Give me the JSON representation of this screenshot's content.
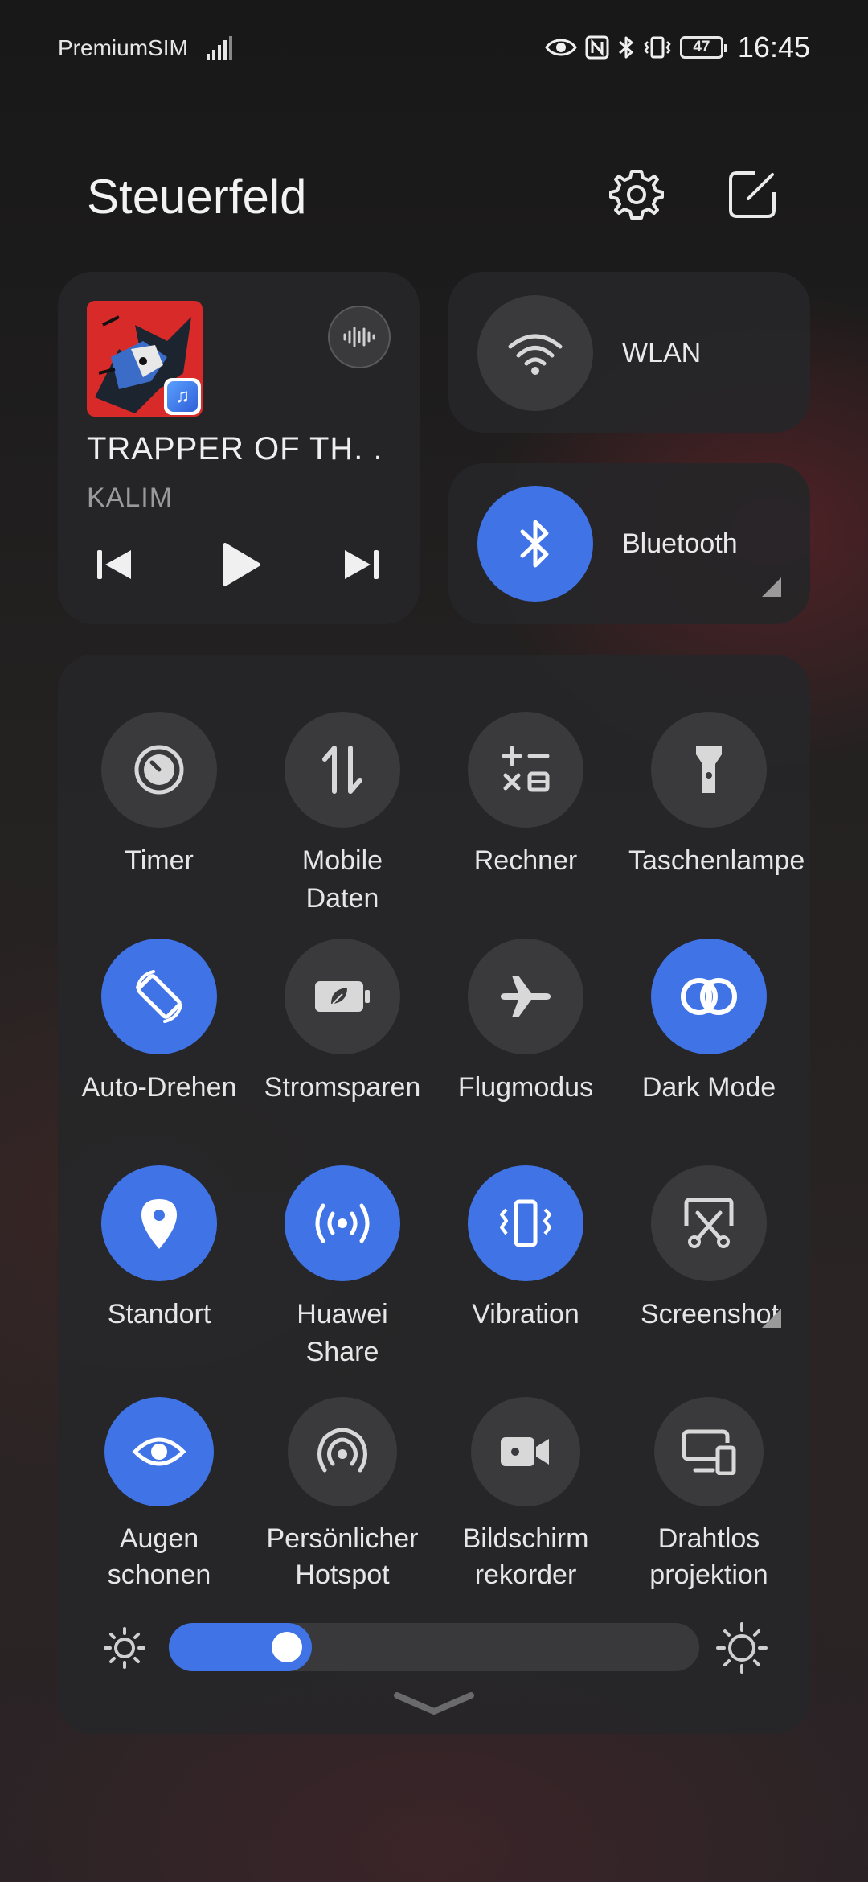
{
  "status_bar": {
    "carrier": "PremiumSIM",
    "battery": "47",
    "time": "16:45",
    "icons": [
      "signal-icon",
      "eye-icon",
      "nfc-icon",
      "bluetooth-icon",
      "vibrate-icon",
      "battery-icon"
    ]
  },
  "header": {
    "title": "Steuerfeld",
    "icons": [
      "settings-icon",
      "edit-icon"
    ]
  },
  "media": {
    "track": "TRAPPER OF TH. .",
    "artist": "KALIM",
    "controls": [
      "previous-icon",
      "play-icon",
      "next-icon"
    ]
  },
  "wlan": {
    "label": "WLAN",
    "state": "off"
  },
  "bluetooth": {
    "label": "Bluetooth",
    "state": "on"
  },
  "tiles": [
    {
      "label": "Timer",
      "state": "off"
    },
    {
      "label": "Mobile Daten",
      "state": "off"
    },
    {
      "label": "Rechner",
      "state": "off"
    },
    {
      "label": "Taschenlampe",
      "state": "off"
    },
    {
      "label": "Auto-Drehen",
      "state": "on"
    },
    {
      "label": "Stromsparen",
      "state": "off"
    },
    {
      "label": "Flugmodus",
      "state": "off"
    },
    {
      "label": "Dark Mode",
      "state": "on"
    },
    {
      "label": "Standort",
      "state": "on"
    },
    {
      "label": "Huawei Share",
      "state": "on"
    },
    {
      "label": "Vibration",
      "state": "on"
    },
    {
      "label": "Screenshot",
      "state": "off"
    },
    {
      "label": "Augen schonen",
      "state": "on"
    },
    {
      "label": "Persönlicher Hotspot",
      "state": "off"
    },
    {
      "label": "Bildschirm rekorder",
      "state": "off"
    },
    {
      "label": "Drahtlos projektion",
      "state": "off"
    }
  ],
  "brightness": {
    "level": 0.27
  },
  "colors": {
    "accent": "#3f73e6",
    "tile_off": "#3a3a3c",
    "card": "#262628"
  }
}
